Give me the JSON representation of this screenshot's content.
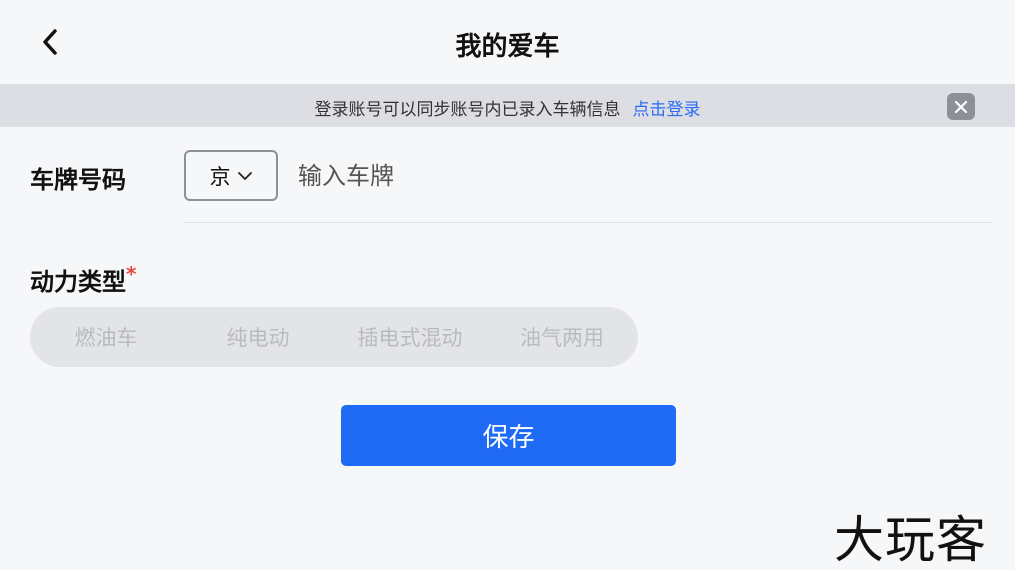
{
  "header": {
    "title": "我的爱车",
    "back_icon": "chevron-left-icon"
  },
  "login_banner": {
    "text": "登录账号可以同步账号内已录入车辆信息",
    "link": "点击登录",
    "close_icon": "close-icon"
  },
  "plate": {
    "label": "车牌号码",
    "province": "京",
    "placeholder": "输入车牌"
  },
  "power_type": {
    "label": "动力类型",
    "required_mark": "*",
    "options": [
      "燃油车",
      "纯电动",
      "插电式混动",
      "油气两用"
    ]
  },
  "save_label": "保存",
  "watermark": "大玩客",
  "colors": {
    "accent": "#1f6bf6",
    "link": "#2b6cf5",
    "required": "#e8483b",
    "background": "#f6f7f9",
    "banner": "#dcdee3"
  }
}
